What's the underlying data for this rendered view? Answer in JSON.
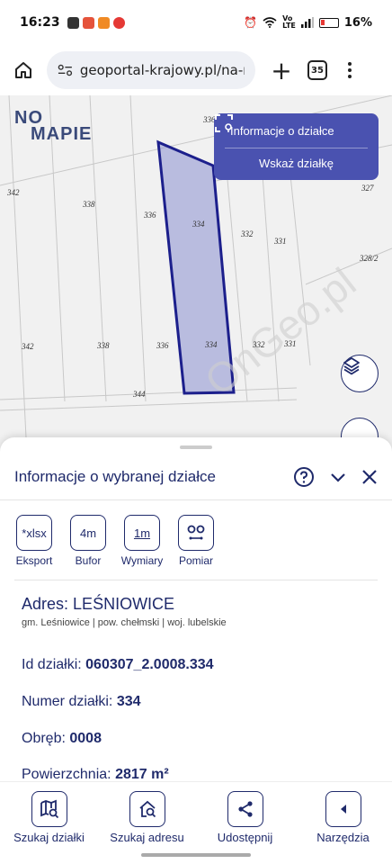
{
  "status": {
    "time": "16:23",
    "percent": "16%"
  },
  "browser": {
    "url": "geoportal-krajowy.pl/na-m",
    "plus": "+",
    "tab_count": "35"
  },
  "map": {
    "logo_line1": "NO",
    "logo_line2": "MAPIE",
    "labels": [
      "336",
      "342",
      "338",
      "336",
      "334",
      "332",
      "331",
      "327",
      "328/2",
      "342",
      "338",
      "336",
      "334",
      "332",
      "331",
      "344"
    ],
    "info_panel": {
      "title": "Informacje o działce",
      "action": "Wskaż działkę"
    },
    "polygon_fill": "#8a8fd0",
    "polygon_stroke": "#1c1f8c"
  },
  "sheet": {
    "title": "Informacje o wybranej działce",
    "tools": [
      {
        "icon_text": "*xlsx",
        "label": "Eksport"
      },
      {
        "icon_text": "4m",
        "label": "Bufor"
      },
      {
        "icon_text": "1m",
        "label": "Wymiary"
      },
      {
        "icon_text": "",
        "label": "Pomiar"
      }
    ],
    "address_label": "Adres:",
    "address_value": "LEŚNIOWICE",
    "address_sub": "gm. Leśniowice | pow. chełmski | woj. lubelskie",
    "fields": [
      {
        "label": "Id działki:",
        "value": "060307_2.0008.334"
      },
      {
        "label": "Numer działki:",
        "value": "334"
      },
      {
        "label": "Obręb:",
        "value": "0008"
      },
      {
        "label": "Powierzchnia:",
        "value": "2817 m²"
      }
    ]
  },
  "nav": [
    {
      "label": "Szukaj działki",
      "icon": "map-search-icon"
    },
    {
      "label": "Szukaj adresu",
      "icon": "home-search-icon"
    },
    {
      "label": "Udostępnij",
      "icon": "share-icon"
    },
    {
      "label": "Narzędzia",
      "icon": "chevron-left-icon"
    }
  ],
  "colors": {
    "brand": "#1f2a6b",
    "panel": "#4a52b0"
  }
}
